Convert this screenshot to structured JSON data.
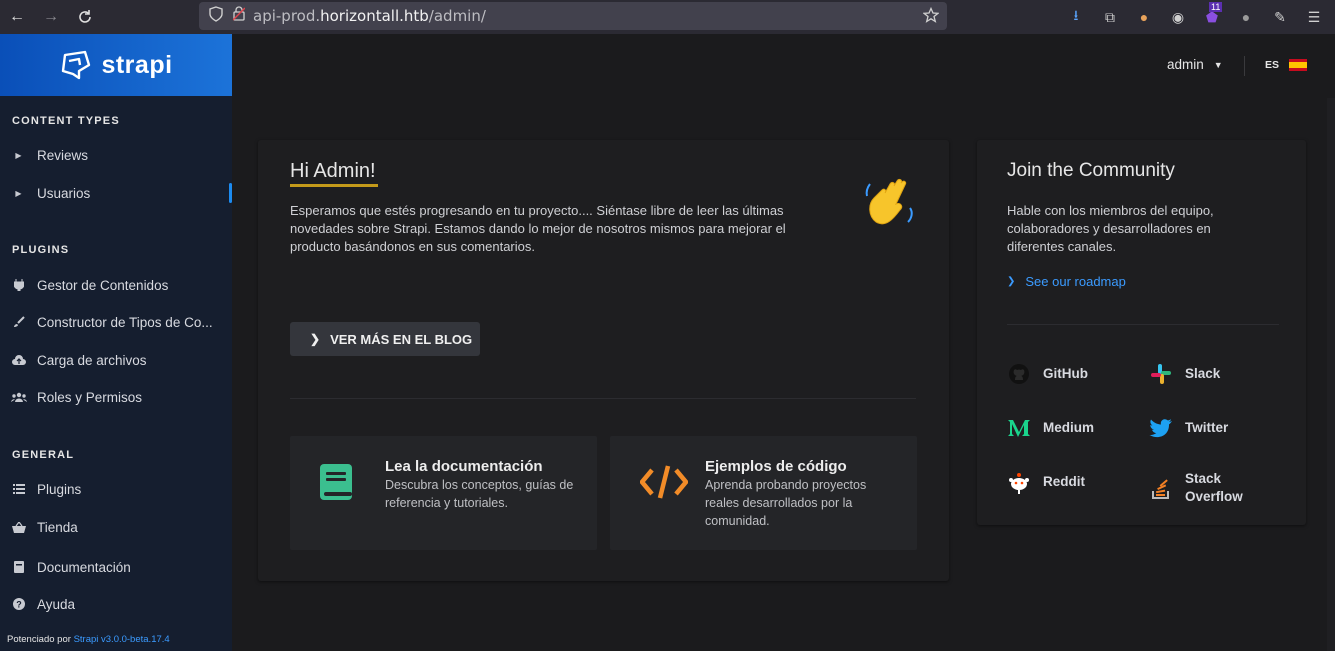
{
  "browser": {
    "url_prefix": "api-prod.",
    "url_host": "horizontall.htb",
    "url_path": "/admin/",
    "badge_count": "11"
  },
  "sidebar": {
    "logo": "strapi",
    "content_types_title": "CONTENT TYPES",
    "content_types": [
      {
        "label": "Reviews"
      },
      {
        "label": "Usuarios"
      }
    ],
    "plugins_title": "PLUGINS",
    "plugins": [
      {
        "label": "Gestor de Contenidos"
      },
      {
        "label": "Constructor de Tipos de Co..."
      },
      {
        "label": "Carga de archivos"
      },
      {
        "label": "Roles y Permisos"
      }
    ],
    "general_title": "GENERAL",
    "general": [
      {
        "label": "Plugins"
      },
      {
        "label": "Tienda"
      },
      {
        "label": "Documentación"
      },
      {
        "label": "Ayuda"
      }
    ],
    "powered_prefix": "Potenciado por",
    "powered_version": "Strapi v3.0.0-beta.17.4"
  },
  "header": {
    "user": "admin",
    "lang": "ES"
  },
  "welcome": {
    "title": "Hi Admin!",
    "text": "Esperamos que estés progresando en tu proyecto.... Siéntase libre de leer las últimas novedades sobre Strapi. Estamos dando lo mejor de nosotros mismos para mejorar el producto basándonos en sus comentarios.",
    "blog_button": "VER MÁS EN EL BLOG",
    "docs_title": "Lea la documentación",
    "docs_desc": "Descubra los conceptos, guías de referencia y tutoriales.",
    "code_title": "Ejemplos de código",
    "code_desc": "Aprenda probando proyectos reales desarrollados por la comunidad."
  },
  "community": {
    "title": "Join the Community",
    "text": "Hable con los miembros del equipo, colaboradores y desarrolladores en diferentes canales.",
    "roadmap": "See our roadmap",
    "links": {
      "github": "GitHub",
      "slack": "Slack",
      "medium": "Medium",
      "twitter": "Twitter",
      "reddit": "Reddit",
      "stackoverflow": "Stack Overflow"
    }
  },
  "colors": {
    "brand_blue": "#1c73d9",
    "accent_gold": "#c49a1a",
    "link_blue": "#3b9bff",
    "code_orange": "#f28c28",
    "docs_green": "#3bbf8f"
  }
}
